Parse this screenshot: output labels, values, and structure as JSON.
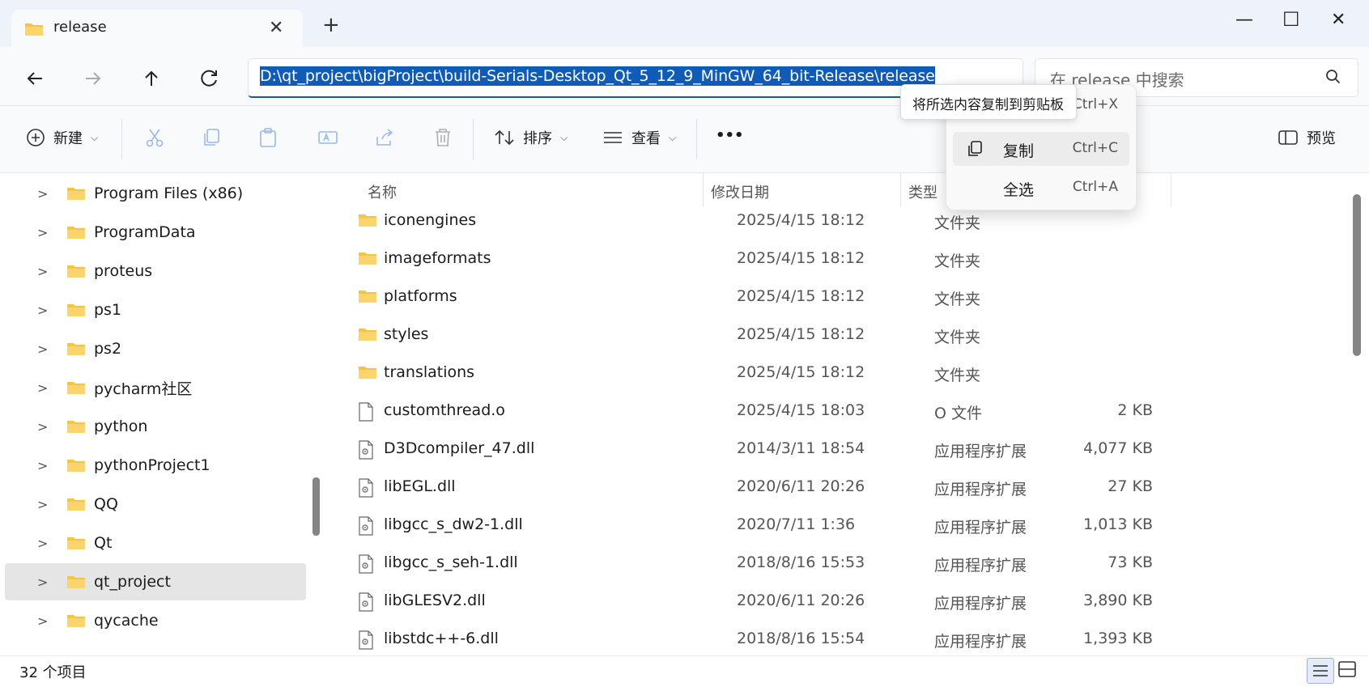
{
  "tab": {
    "title": "release"
  },
  "address": {
    "path": "D:\\qt_project\\bigProject\\build-Serials-Desktop_Qt_5_12_9_MinGW_64_bit-Release\\release"
  },
  "search": {
    "placeholder": "在 release 中搜索"
  },
  "toolbar": {
    "new_label": "新建",
    "sort_label": "排序",
    "view_label": "查看",
    "more_label": "•••",
    "preview_label": "预览"
  },
  "sidebar": {
    "items": [
      {
        "label": "Program Files (x86)"
      },
      {
        "label": "ProgramData"
      },
      {
        "label": "proteus"
      },
      {
        "label": "ps1"
      },
      {
        "label": "ps2"
      },
      {
        "label": "pycharm社区"
      },
      {
        "label": "python"
      },
      {
        "label": "pythonProject1"
      },
      {
        "label": "QQ"
      },
      {
        "label": "Qt"
      },
      {
        "label": "qt_project"
      },
      {
        "label": "qycache"
      }
    ],
    "selected_index": 10
  },
  "columns": {
    "name": "名称",
    "date": "修改日期",
    "type": "类型"
  },
  "files": [
    {
      "name": "iconengines",
      "date": "2025/4/15 18:12",
      "type": "文件夹",
      "size": "",
      "kind": "folder"
    },
    {
      "name": "imageformats",
      "date": "2025/4/15 18:12",
      "type": "文件夹",
      "size": "",
      "kind": "folder"
    },
    {
      "name": "platforms",
      "date": "2025/4/15 18:12",
      "type": "文件夹",
      "size": "",
      "kind": "folder"
    },
    {
      "name": "styles",
      "date": "2025/4/15 18:12",
      "type": "文件夹",
      "size": "",
      "kind": "folder"
    },
    {
      "name": "translations",
      "date": "2025/4/15 18:12",
      "type": "文件夹",
      "size": "",
      "kind": "folder"
    },
    {
      "name": "customthread.o",
      "date": "2025/4/15 18:03",
      "type": "O 文件",
      "size": "2 KB",
      "kind": "file"
    },
    {
      "name": "D3Dcompiler_47.dll",
      "date": "2014/3/11 18:54",
      "type": "应用程序扩展",
      "size": "4,077 KB",
      "kind": "dll"
    },
    {
      "name": "libEGL.dll",
      "date": "2020/6/11 20:26",
      "type": "应用程序扩展",
      "size": "27 KB",
      "kind": "dll"
    },
    {
      "name": "libgcc_s_dw2-1.dll",
      "date": "2020/7/11 1:36",
      "type": "应用程序扩展",
      "size": "1,013 KB",
      "kind": "dll"
    },
    {
      "name": "libgcc_s_seh-1.dll",
      "date": "2018/8/16 15:53",
      "type": "应用程序扩展",
      "size": "73 KB",
      "kind": "dll"
    },
    {
      "name": "libGLESV2.dll",
      "date": "2020/6/11 20:26",
      "type": "应用程序扩展",
      "size": "3,890 KB",
      "kind": "dll"
    },
    {
      "name": "libstdc++-6.dll",
      "date": "2018/8/16 15:54",
      "type": "应用程序扩展",
      "size": "1,393 KB",
      "kind": "dll"
    }
  ],
  "status": {
    "count_text": "32 个项目"
  },
  "context_menu": {
    "items": [
      {
        "label": "",
        "shortcut": "Ctrl+X"
      },
      {
        "label": "复制",
        "shortcut": "Ctrl+C"
      },
      {
        "label": "全选",
        "shortcut": "Ctrl+A"
      }
    ]
  },
  "tooltip": {
    "text": "将所选内容复制到剪贴板"
  },
  "colors": {
    "accent": "#0f5bb5",
    "folder": "#f6c343",
    "selection": "#e5e5e5"
  }
}
